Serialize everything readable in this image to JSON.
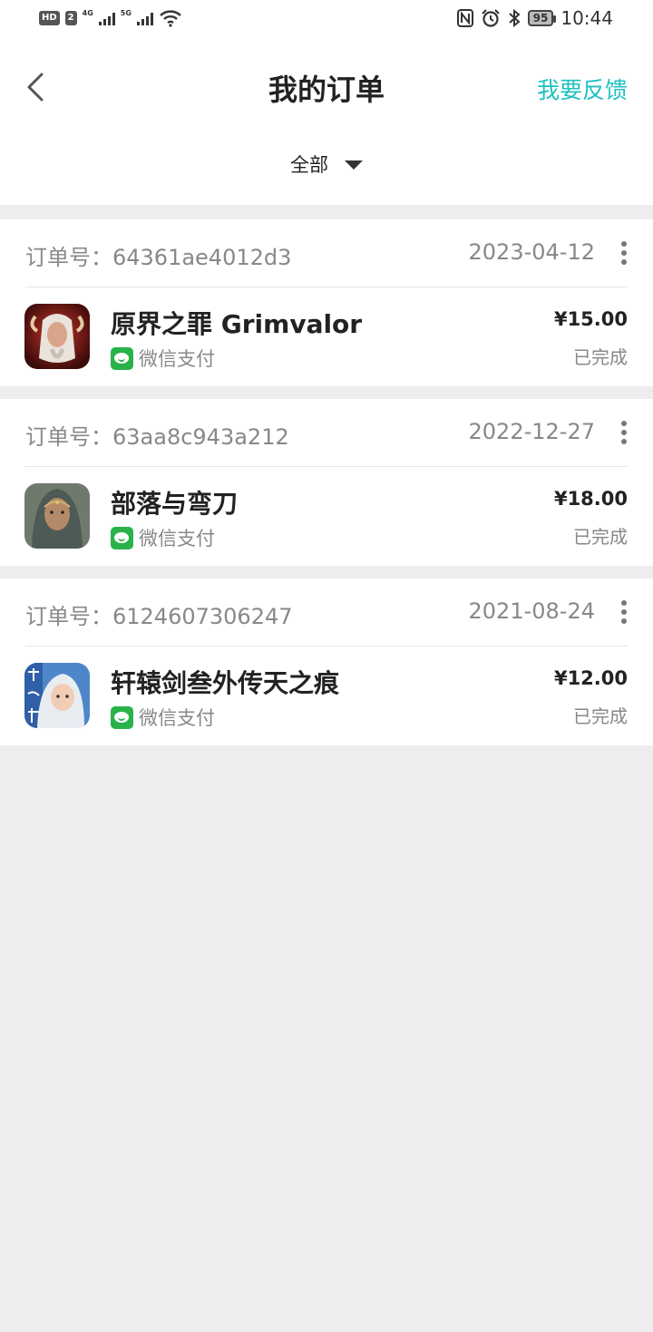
{
  "status_bar": {
    "hd": "HD",
    "sim": "2",
    "net1": "4G",
    "net2": "5G",
    "battery": "95",
    "time": "10:44"
  },
  "nav": {
    "title": "我的订单",
    "feedback": "我要反馈"
  },
  "filter": {
    "label": "全部"
  },
  "orders": [
    {
      "order_no": "订单号：64361ae4012d3",
      "date": "2023-04-12",
      "game": "原界之罪 Grimvalor",
      "payment": "微信支付",
      "price": "¥15.00",
      "status": "已完成"
    },
    {
      "order_no": "订单号：63aa8c943a212",
      "date": "2022-12-27",
      "game": "部落与弯刀",
      "payment": "微信支付",
      "price": "¥18.00",
      "status": "已完成"
    },
    {
      "order_no": "订单号：6124607306247",
      "date": "2021-08-24",
      "game": "轩辕剑叁外传天之痕",
      "payment": "微信支付",
      "price": "¥12.00",
      "status": "已完成"
    }
  ],
  "colors": {
    "accent": "#1ec0c2",
    "wechat": "#2ab24a",
    "background": "#ededed"
  }
}
